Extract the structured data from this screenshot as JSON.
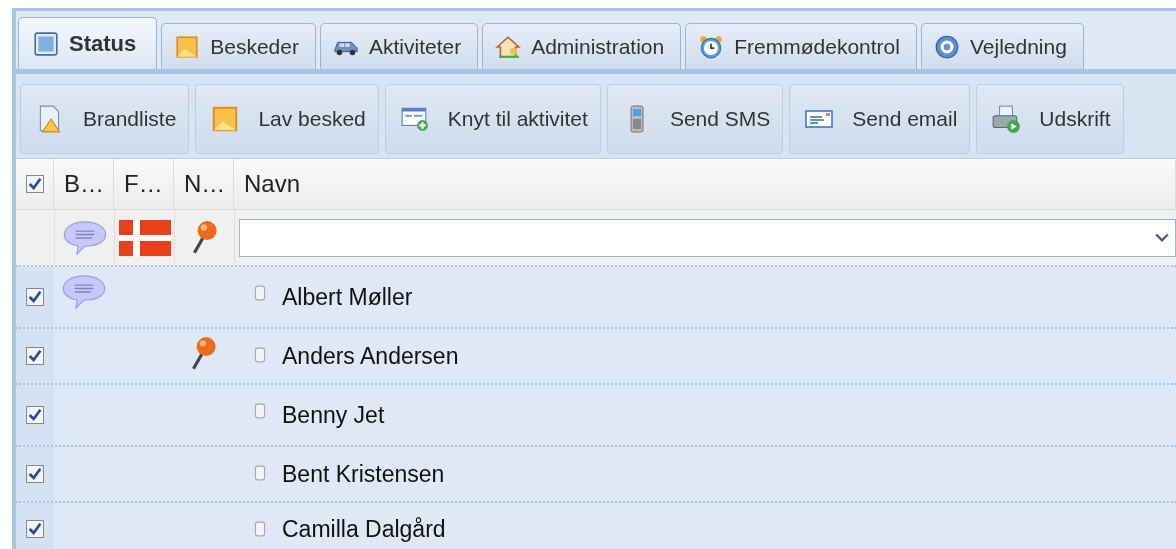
{
  "tabs": [
    {
      "label": "Status",
      "selected": true
    },
    {
      "label": "Beskeder",
      "selected": false
    },
    {
      "label": "Aktiviteter",
      "selected": false
    },
    {
      "label": "Administration",
      "selected": false
    },
    {
      "label": "Fremmødekontrol",
      "selected": false
    },
    {
      "label": "Vejledning",
      "selected": false
    }
  ],
  "toolbar": [
    "Brandliste",
    "Lav besked",
    "Knyt til aktivitet",
    "Send SMS",
    "Send email",
    "Udskrift"
  ],
  "table": {
    "all_checked": true,
    "columns": [
      "B…",
      "F…",
      "N…",
      "Navn"
    ],
    "rows": [
      {
        "name": "Albert Møller",
        "checked": true,
        "selected": true,
        "message": true,
        "pin": false
      },
      {
        "name": "Anders Andersen",
        "checked": true,
        "selected": true,
        "message": false,
        "pin": true
      },
      {
        "name": "Benny Jet",
        "checked": true,
        "selected": true,
        "message": false,
        "pin": false
      },
      {
        "name": "Bent Kristensen",
        "checked": true,
        "selected": true,
        "message": false,
        "pin": false
      },
      {
        "name": "Camilla Dalgård",
        "checked": true,
        "selected": true,
        "message": false,
        "pin": false
      }
    ]
  }
}
